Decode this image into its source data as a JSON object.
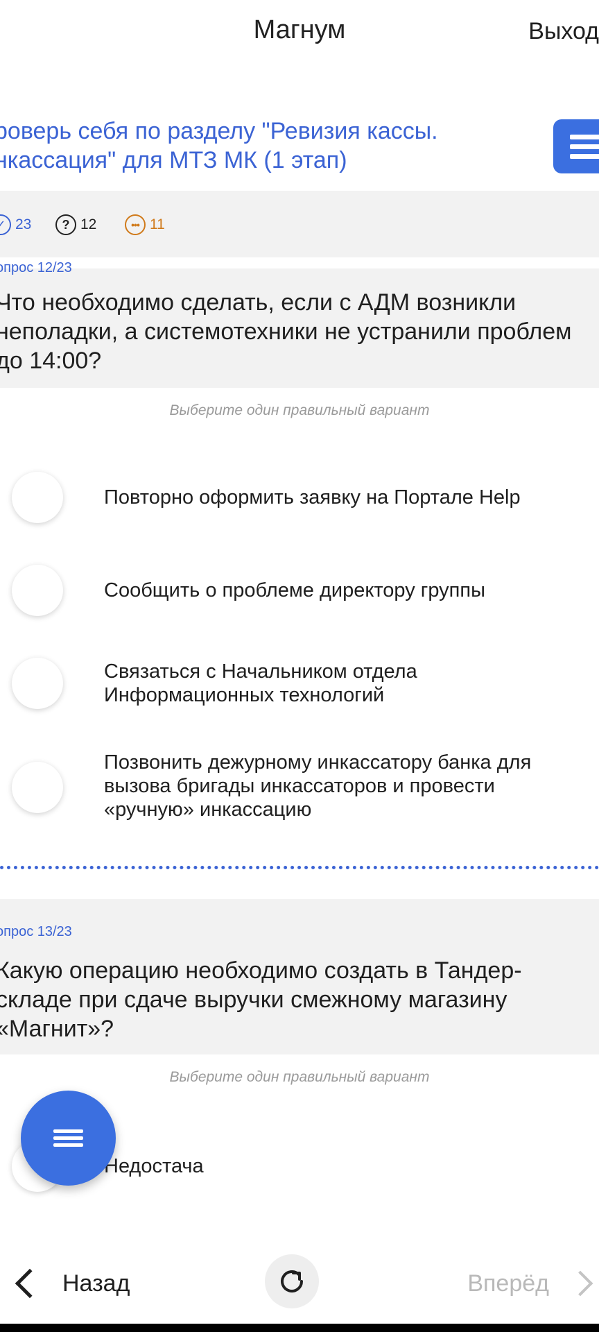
{
  "header": {
    "title": "Магнум",
    "logout_label": "Выход"
  },
  "test": {
    "title_line1": "роверь себя по разделу \"Ревизия кассы.",
    "title_line2": "нкассация\" для МТЗ МК (1 этап)"
  },
  "stats": {
    "total": "23",
    "unanswered": "12",
    "skipped": "11",
    "colors": {
      "total": "#3b63d4",
      "unanswered": "#222222",
      "skipped": "#d07a1a"
    }
  },
  "questions": [
    {
      "counter": "опрос 12/23",
      "text_lines": [
        "Что необходимо сделать, если с АДМ возникли",
        "неполадки, а системотехники не устранили проблем",
        "до 14:00?"
      ],
      "hint": "Выберите один правильный вариант",
      "options": [
        {
          "lines": [
            "Повторно оформить заявку на Портале Help"
          ]
        },
        {
          "lines": [
            "Сообщить о проблеме директору группы"
          ]
        },
        {
          "lines": [
            "Связаться с Начальником отдела",
            "Информационных технологий"
          ]
        },
        {
          "lines": [
            "Позвонить дежурному инкассатору банка для",
            "вызова бригады инкассаторов и провести",
            "«ручную» инкассацию"
          ]
        }
      ]
    },
    {
      "counter": "опрос 13/23",
      "text_lines": [
        "Какую операцию необходимо создать в Тандер-",
        "складе при сдаче выручки смежному магазину",
        "«Магнит»?"
      ],
      "hint": "Выберите один правильный вариант",
      "options": [
        {
          "lines": [
            "Недостача"
          ]
        }
      ]
    }
  ],
  "nav": {
    "back_label": "Назад",
    "forward_label": "Вперёд"
  },
  "icons": {
    "menu": "hamburger-icon",
    "refresh": "refresh-icon",
    "back": "chevron-left-icon",
    "forward": "chevron-right-icon"
  },
  "colors": {
    "accent": "#3b6fe0",
    "link_text": "#3b63d4",
    "panel_bg": "#f2f2f2",
    "hint_text": "#9a9a9a"
  }
}
